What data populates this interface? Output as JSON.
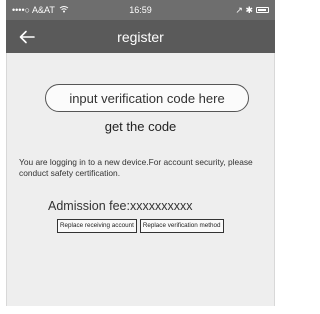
{
  "status_bar": {
    "carrier": "••••○ A&AT",
    "time": "16:59",
    "right_indicators": "↗ ✱"
  },
  "nav": {
    "title": "register",
    "back_icon": "arrow-left-icon"
  },
  "form": {
    "code_placeholder": "input verification code here",
    "get_code_label": "get the code",
    "notice": "You are logging in to a new device.For account security, please conduct safety certification.",
    "fee": "Admission fee:xxxxxxxxxx",
    "replace_account_label": "Replace receiving account",
    "replace_method_label": "Replace verification method"
  },
  "colors": {
    "status_bar": "#6e6e6e",
    "nav_bar": "#5a5a5a",
    "content_bg": "#eeeeee"
  }
}
